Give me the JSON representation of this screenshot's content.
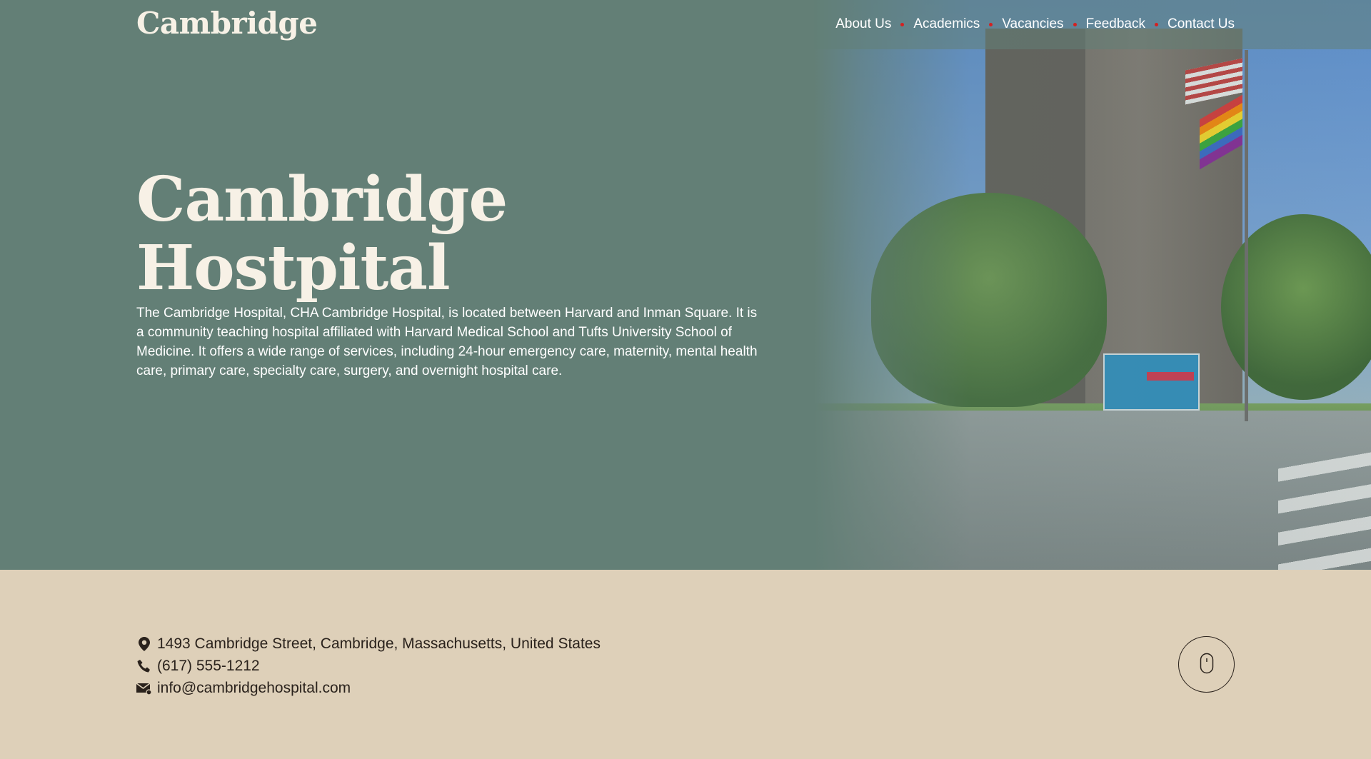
{
  "brand": {
    "logo_text": "Cambridge"
  },
  "nav": {
    "items": [
      {
        "label": "About Us"
      },
      {
        "label": "Academics"
      },
      {
        "label": "Vacancies"
      },
      {
        "label": "Feedback"
      },
      {
        "label": "Contact Us"
      }
    ],
    "separator_color": "#d52020"
  },
  "hero": {
    "title_line1": "Cambridge",
    "title_line2": "Hostpital",
    "description": "The Cambridge Hospital, CHA Cambridge Hospital, is located between Harvard and Inman Square. It is a community teaching hospital affiliated with Harvard Medical School and Tufts University School of Medicine. It offers a wide range of services, including 24-hour emergency care, maternity, mental health care, primary care, specialty care, surgery, and overnight hospital care.",
    "background_color": "#637f76"
  },
  "contact": {
    "address": "1493 Cambridge Street, Cambridge, Massachusetts, United States",
    "phone": "(617) 555-1212",
    "email": "info@cambridgehospital.com",
    "icons": [
      "location-pin-icon",
      "phone-icon",
      "envelope-icon"
    ]
  },
  "footer": {
    "background_color": "#ded0b9",
    "scroll_icon": "mouse-icon"
  }
}
